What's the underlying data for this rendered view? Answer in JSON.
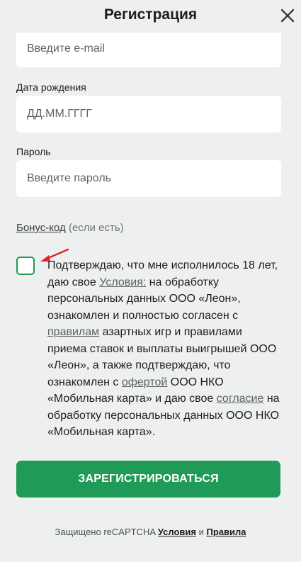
{
  "header": {
    "title": "Регистрация",
    "close_icon": "close-icon"
  },
  "form": {
    "email": {
      "placeholder": "Введите e-mail"
    },
    "birthdate": {
      "label": "Дата рождения",
      "placeholder": "ДД.ММ.ГГГГ"
    },
    "password": {
      "label": "Пароль",
      "placeholder": "Введите пароль"
    },
    "bonus": {
      "link": "Бонус-код",
      "suffix": " (если есть)"
    }
  },
  "consent": {
    "checked": false,
    "t1": "Подтверждаю, что мне исполнилось 18 лет, даю свое ",
    "link1": "Условия:",
    "t2": " на обработку персональных данных ООО «Леон», ознакомлен и полностью согласен с ",
    "link2": "правилам",
    "t3": " азартных игр и правилами приема ставок и выплаты выигрышей ООО «Леон», а также подтверждаю, что ознакомлен с ",
    "link3": "офертой",
    "t4": " ООО НКО «Мобильная карта» и даю свое ",
    "link4": "согласие",
    "t5": " на обработку персональных данных ООО НКО «Мобильная карта»."
  },
  "register_button": "ЗАРЕГИСТРИРОВАТЬСЯ",
  "recaptcha": {
    "text": "Защищено reCAPTCHA ",
    "terms": "Условия",
    "and": " и ",
    "rules": "Правила"
  },
  "colors": {
    "accent": "#1f9a57",
    "background": "#eef0f0",
    "arrow": "#e0252a"
  }
}
